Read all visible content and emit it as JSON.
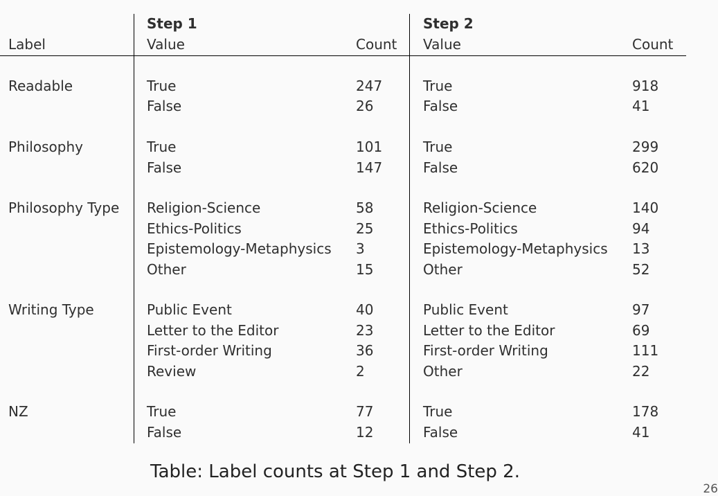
{
  "table": {
    "header": {
      "label": "Label",
      "steps": [
        "Step 1",
        "Step 2"
      ],
      "value": "Value",
      "count": "Count"
    },
    "groups": [
      {
        "label": "Readable",
        "rows": [
          {
            "v1": "True",
            "c1": "247",
            "v2": "True",
            "c2": "918"
          },
          {
            "v1": "False",
            "c1": "26",
            "v2": "False",
            "c2": "41"
          }
        ]
      },
      {
        "label": "Philosophy",
        "rows": [
          {
            "v1": "True",
            "c1": "101",
            "v2": "True",
            "c2": "299"
          },
          {
            "v1": "False",
            "c1": "147",
            "v2": "False",
            "c2": "620"
          }
        ]
      },
      {
        "label": "Philosophy Type",
        "rows": [
          {
            "v1": "Religion-Science",
            "c1": "58",
            "v2": "Religion-Science",
            "c2": "140"
          },
          {
            "v1": "Ethics-Politics",
            "c1": "25",
            "v2": "Ethics-Politics",
            "c2": "94"
          },
          {
            "v1": "Epistemology-Metaphysics",
            "c1": "3",
            "v2": "Epistemology-Metaphysics",
            "c2": "13"
          },
          {
            "v1": "Other",
            "c1": "15",
            "v2": "Other",
            "c2": "52"
          }
        ]
      },
      {
        "label": "Writing Type",
        "rows": [
          {
            "v1": "Public Event",
            "c1": "40",
            "v2": "Public Event",
            "c2": "97"
          },
          {
            "v1": "Letter to the Editor",
            "c1": "23",
            "v2": "Letter to the Editor",
            "c2": "69"
          },
          {
            "v1": "First-order Writing",
            "c1": "36",
            "v2": "First-order Writing",
            "c2": "111"
          },
          {
            "v1": "Review",
            "c1": "2",
            "v2": "Other",
            "c2": "22"
          }
        ]
      },
      {
        "label": "NZ",
        "rows": [
          {
            "v1": "True",
            "c1": "77",
            "v2": "True",
            "c2": "178"
          },
          {
            "v1": "False",
            "c1": "12",
            "v2": "False",
            "c2": "41"
          }
        ]
      }
    ]
  },
  "caption": {
    "label": "Table:",
    "text": "Label counts at Step 1 and Step 2."
  },
  "page_number": "26"
}
